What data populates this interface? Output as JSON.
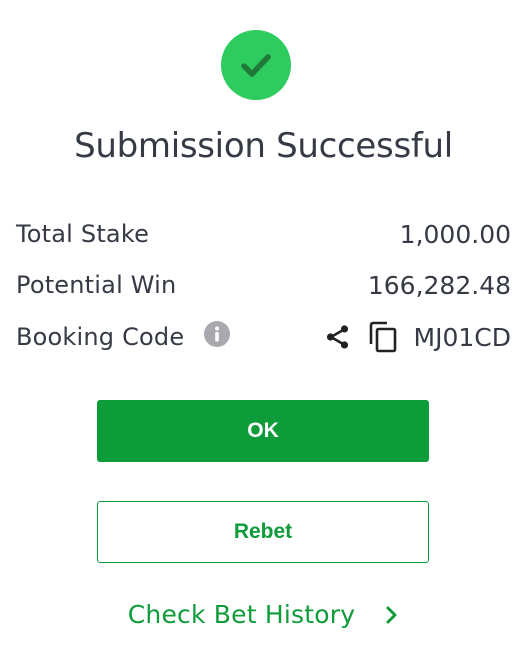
{
  "dialog": {
    "title": "Submission Successful",
    "icon": "checkmark-icon",
    "accent_color": "#2ecc5f"
  },
  "summary": {
    "total_stake_label": "Total Stake",
    "total_stake_value": "1,000.00",
    "potential_win_label": "Potential Win",
    "potential_win_value": "166,282.48",
    "booking_code_label": "Booking Code",
    "booking_code_value": "MJ01CD",
    "booking_code_icons": [
      "info-icon",
      "share-icon",
      "copy-icon"
    ]
  },
  "actions": {
    "ok_label": "OK",
    "rebet_label": "Rebet",
    "history_label": "Check Bet History",
    "brand_color": "#0e9b3a"
  }
}
